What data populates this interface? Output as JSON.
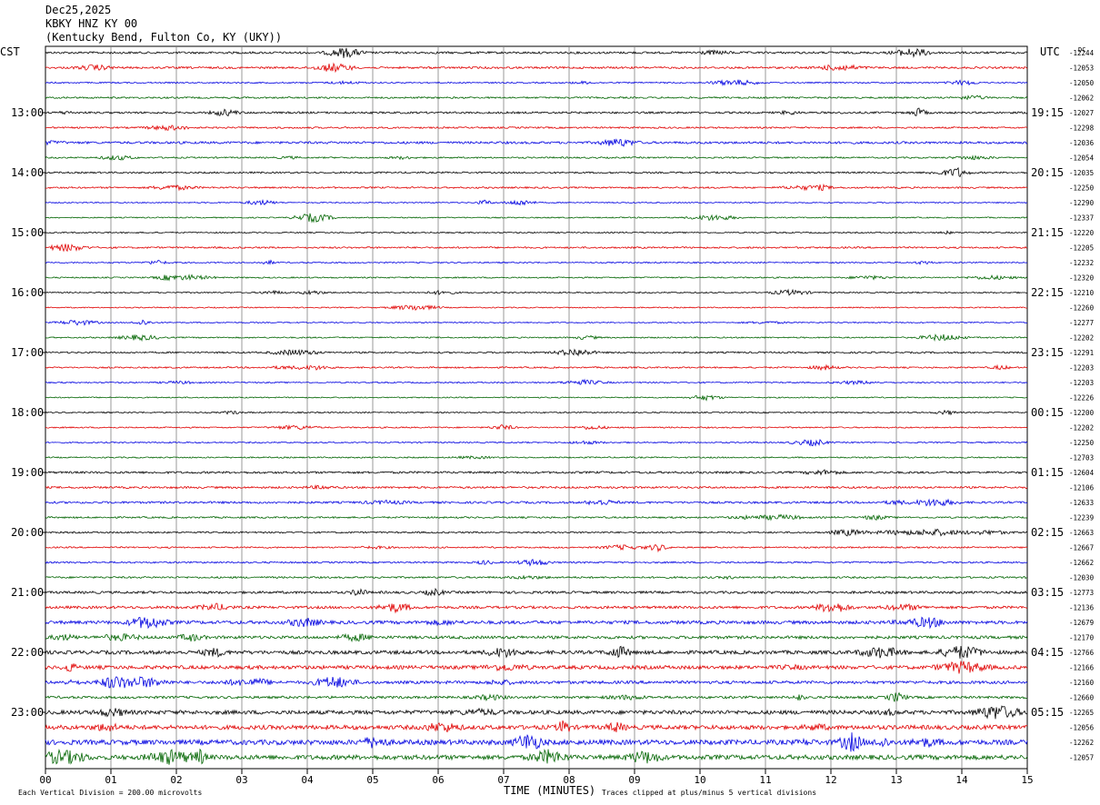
{
  "header": {
    "date": "Dec25,2025",
    "station": "KBKY HNZ KY 00",
    "location": "(Kentucky Bend, Fulton Co, KY (UKY))"
  },
  "chart_data": {
    "type": "line",
    "title": "",
    "left_axis_label": "CST",
    "right_axis_label": "UTC",
    "dc_label": "DC",
    "xlabel": "TIME (MINUTES)",
    "x_ticks": [
      "00",
      "01",
      "02",
      "03",
      "04",
      "05",
      "06",
      "07",
      "08",
      "09",
      "10",
      "11",
      "12",
      "13",
      "14",
      "15"
    ],
    "xlim": [
      0,
      15
    ],
    "left_hour_labels": [
      "13:00",
      "14:00",
      "15:00",
      "16:00",
      "17:00",
      "18:00",
      "19:00",
      "20:00",
      "21:00",
      "22:00",
      "23:00"
    ],
    "right_hour_labels": [
      "19:15",
      "20:15",
      "21:15",
      "22:15",
      "23:15",
      "00:15",
      "01:15",
      "02:15",
      "03:15",
      "04:15",
      "05:15"
    ],
    "trace_colors": [
      "#000000",
      "#e00000",
      "#0000e0",
      "#006400"
    ],
    "grid": true,
    "dc_offsets": [
      "-12244",
      "-12053",
      "-12050",
      "-12062",
      "-12027",
      "-12298",
      "-12036",
      "-12054",
      "-12035",
      "-12250",
      "-12290",
      "-12337",
      "-12220",
      "-12205",
      "-12232",
      "-12320",
      "-12210",
      "-12260",
      "-12277",
      "-12202",
      "-12291",
      "-12203",
      "-12203",
      "-12226",
      "-12200",
      "-12202",
      "-12250",
      "-12703",
      "-12604",
      "-12106",
      "-12633",
      "-12239",
      "-12663",
      "-12667",
      "-12662",
      "-12030",
      "-12773",
      "-12136",
      "-12679",
      "-12170",
      "-12766",
      "-12166",
      "-12160",
      "-12660",
      "-12265",
      "-12056",
      "-12262",
      "-12057"
    ],
    "trace_activity": [
      1.3,
      1.2,
      0.8,
      1.0,
      1.2,
      1.0,
      1.4,
      0.9,
      1.0,
      1.0,
      0.7,
      0.7,
      0.8,
      1.0,
      0.8,
      0.8,
      0.8,
      0.7,
      0.7,
      0.8,
      1.0,
      0.9,
      0.8,
      0.7,
      0.8,
      0.8,
      0.8,
      0.8,
      1.3,
      1.2,
      1.3,
      1.0,
      1.0,
      0.9,
      1.0,
      1.1,
      1.5,
      1.6,
      2.0,
      1.8,
      2.2,
      2.2,
      1.8,
      1.5,
      2.4,
      2.6,
      3.0,
      2.8
    ],
    "footer_left": "Each Vertical Division =  200.00 microvolts",
    "footer_right": "Traces clipped at plus/minus 5 vertical divisions"
  }
}
